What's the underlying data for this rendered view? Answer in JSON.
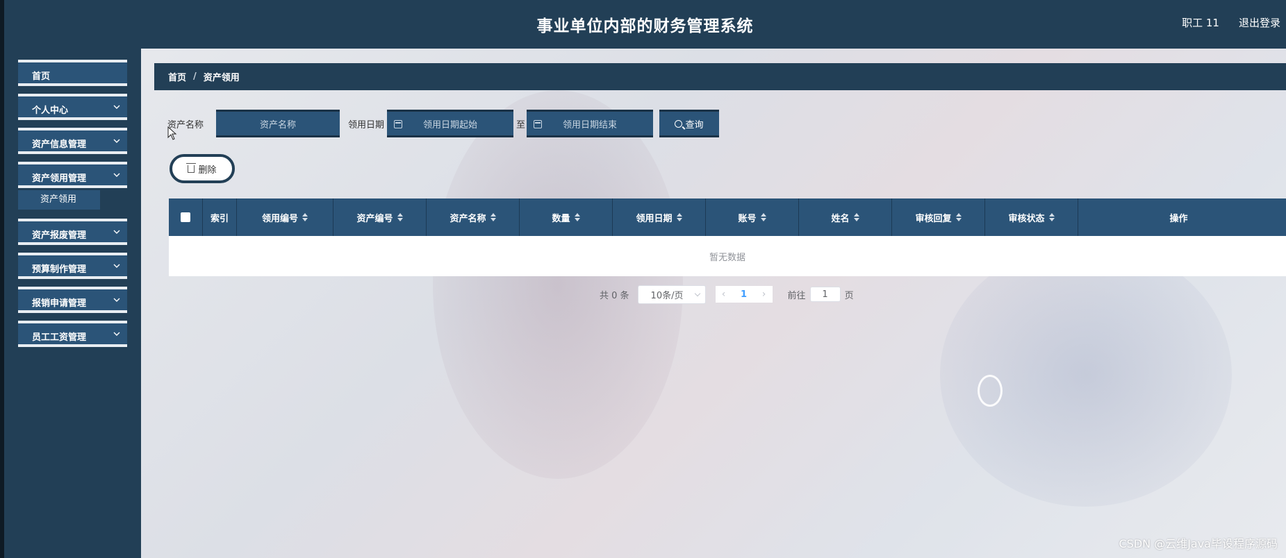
{
  "header": {
    "title": "事业单位内部的财务管理系统",
    "user": "职工 11",
    "logout": "退出登录"
  },
  "sidebar": {
    "items": [
      {
        "label": "首页",
        "has_chevron": false
      },
      {
        "label": "个人中心",
        "has_chevron": true
      },
      {
        "label": "资产信息管理",
        "has_chevron": true
      },
      {
        "label": "资产领用管理",
        "has_chevron": true
      },
      {
        "label": "资产报废管理",
        "has_chevron": true
      },
      {
        "label": "预算制作管理",
        "has_chevron": true
      },
      {
        "label": "报销申请管理",
        "has_chevron": true
      },
      {
        "label": "员工工资管理",
        "has_chevron": true
      }
    ],
    "submenu_active": "资产领用"
  },
  "breadcrumb": {
    "home": "首页",
    "separator": "/",
    "current": "资产领用"
  },
  "search": {
    "asset_name_label": "资产名称",
    "asset_name_placeholder": "资产名称",
    "date_label": "领用日期",
    "date_start_placeholder": "领用日期起始",
    "to_label": "至",
    "date_end_placeholder": "领用日期结束",
    "query_button": "查询"
  },
  "actions": {
    "delete_button": "删除"
  },
  "table": {
    "headers": [
      "索引",
      "领用编号",
      "资产编号",
      "资产名称",
      "数量",
      "领用日期",
      "账号",
      "姓名",
      "审核回复",
      "审核状态",
      "操作"
    ],
    "empty_text": "暂无数据"
  },
  "pagination": {
    "total": "共 0 条",
    "page_size": "10条/页",
    "current_page": "1",
    "goto_label": "前往",
    "goto_value": "1",
    "page_suffix": "页"
  },
  "watermark": "CSDN @云维Java毕设程序源码",
  "colors": {
    "header_bg": "#223f56",
    "menu_bg": "#2b5478",
    "table_header_bg": "#2b5478",
    "pager_active": "#409eff"
  }
}
